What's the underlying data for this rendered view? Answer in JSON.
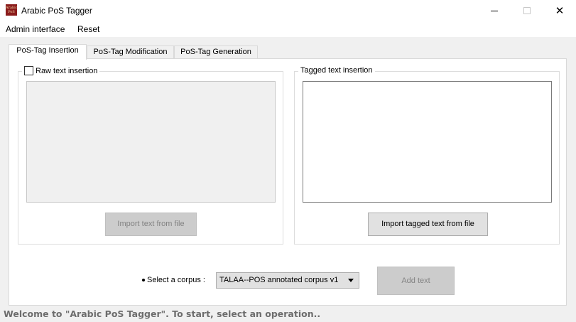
{
  "window": {
    "title": "Arabic PoS Tagger",
    "icon_text": "Arabic PoS Tagger",
    "minimize_glyph": "—",
    "maximize_glyph": "☐",
    "close_glyph": "✕"
  },
  "menu": {
    "items": [
      {
        "label": "Admin interface"
      },
      {
        "label": "Reset"
      }
    ]
  },
  "tabs": [
    {
      "label": "PoS-Tag Insertion",
      "active": true
    },
    {
      "label": "PoS-Tag Modification",
      "active": false
    },
    {
      "label": "PoS-Tag Generation",
      "active": false
    }
  ],
  "raw_group": {
    "title": "Raw text insertion",
    "checked": false,
    "import_button": "Import text from file"
  },
  "tagged_group": {
    "title": "Tagged text insertion",
    "import_button": "Import tagged text from file"
  },
  "corpus": {
    "label": "Select a corpus :",
    "selected": "TALAA--POS annotated corpus v1"
  },
  "add_button": "Add text",
  "status": "Welcome to \"Arabic PoS Tagger\". To start, select an operation..",
  "colors": {
    "app_icon": "#8b1c1c",
    "disabled_button": "#cccccc",
    "status_text": "#6d6d6d"
  }
}
